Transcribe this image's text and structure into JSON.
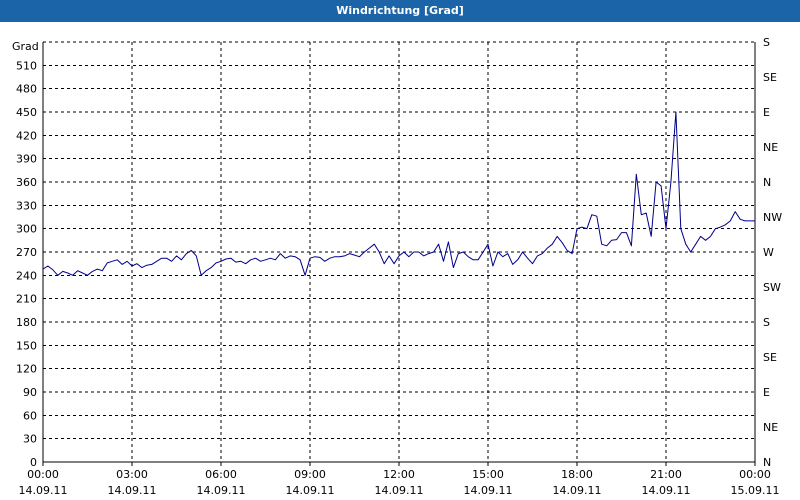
{
  "window": {
    "title": "Windrichtung [Grad]"
  },
  "colors": {
    "title_bar": "#1c64a8",
    "series": "#00008b",
    "grid": "#000000"
  },
  "chart_data": {
    "type": "line",
    "title": "Windrichtung [Grad]",
    "ylabel": "Grad",
    "ylim": [
      0,
      540
    ],
    "xlim": [
      "14.09.11 00:00",
      "15.09.11 00:00"
    ],
    "grid": true,
    "y_ticks": [
      0,
      30,
      60,
      90,
      120,
      150,
      180,
      210,
      240,
      270,
      300,
      330,
      360,
      390,
      420,
      450,
      480,
      510
    ],
    "x_ticks": [
      {
        "time": "00:00",
        "date": "14.09.11"
      },
      {
        "time": "03:00",
        "date": "14.09.11"
      },
      {
        "time": "06:00",
        "date": "14.09.11"
      },
      {
        "time": "09:00",
        "date": "14.09.11"
      },
      {
        "time": "12:00",
        "date": "14.09.11"
      },
      {
        "time": "15:00",
        "date": "14.09.11"
      },
      {
        "time": "18:00",
        "date": "14.09.11"
      },
      {
        "time": "21:00",
        "date": "14.09.11"
      },
      {
        "time": "00:00",
        "date": "15.09.11"
      }
    ],
    "right_axis": {
      "labels": [
        {
          "value": 0,
          "label": "N"
        },
        {
          "value": 45,
          "label": "NE"
        },
        {
          "value": 90,
          "label": "E"
        },
        {
          "value": 135,
          "label": "SE"
        },
        {
          "value": 180,
          "label": "S"
        },
        {
          "value": 225,
          "label": "SW"
        },
        {
          "value": 270,
          "label": "W"
        },
        {
          "value": 315,
          "label": "NW"
        },
        {
          "value": 360,
          "label": "N"
        },
        {
          "value": 405,
          "label": "NE"
        },
        {
          "value": 450,
          "label": "E"
        },
        {
          "value": 495,
          "label": "SE"
        },
        {
          "value": 540,
          "label": "S"
        }
      ]
    },
    "series": [
      {
        "x": [
          "00:00",
          "00:10",
          "00:20",
          "00:30",
          "00:40",
          "00:50",
          "01:00",
          "01:10",
          "01:20",
          "01:30",
          "01:40",
          "01:50",
          "02:00",
          "02:10",
          "02:20",
          "02:30",
          "02:40",
          "02:50",
          "03:00",
          "03:10",
          "03:20",
          "03:30",
          "03:40",
          "03:50",
          "04:00",
          "04:10",
          "04:20",
          "04:30",
          "04:40",
          "04:50",
          "05:00",
          "05:10",
          "05:20",
          "05:30",
          "05:40",
          "05:50",
          "06:00",
          "06:10",
          "06:20",
          "06:30",
          "06:40",
          "06:50",
          "07:00",
          "07:10",
          "07:20",
          "07:30",
          "07:40",
          "07:50",
          "08:00",
          "08:10",
          "08:20",
          "08:30",
          "08:40",
          "08:50",
          "09:00",
          "09:10",
          "09:20",
          "09:30",
          "09:40",
          "09:50",
          "10:00",
          "10:10",
          "10:20",
          "10:30",
          "10:40",
          "10:50",
          "11:00",
          "11:10",
          "11:20",
          "11:30",
          "11:40",
          "11:50",
          "12:00",
          "12:10",
          "12:20",
          "12:30",
          "12:40",
          "12:50",
          "13:00",
          "13:10",
          "13:20",
          "13:30",
          "13:40",
          "13:50",
          "14:00",
          "14:10",
          "14:20",
          "14:30",
          "14:40",
          "14:50",
          "15:00",
          "15:10",
          "15:20",
          "15:30",
          "15:40",
          "15:50",
          "16:00",
          "16:10",
          "16:20",
          "16:30",
          "16:40",
          "16:50",
          "17:00",
          "17:10",
          "17:20",
          "17:30",
          "17:40",
          "17:50",
          "18:00",
          "18:10",
          "18:20",
          "18:30",
          "18:40",
          "18:50",
          "19:00",
          "19:10",
          "19:20",
          "19:30",
          "19:40",
          "19:50",
          "20:00",
          "20:10",
          "20:20",
          "20:30",
          "20:40",
          "20:50",
          "21:00",
          "21:10",
          "21:20",
          "21:30",
          "21:40",
          "21:50",
          "22:00",
          "22:10",
          "22:20",
          "22:30",
          "22:40",
          "22:50",
          "23:00",
          "23:10",
          "23:20",
          "23:30",
          "23:40",
          "23:50",
          "24:00"
        ],
        "values": [
          248,
          252,
          247,
          240,
          245,
          243,
          240,
          246,
          243,
          240,
          245,
          248,
          246,
          256,
          258,
          260,
          254,
          258,
          252,
          255,
          250,
          253,
          254,
          258,
          262,
          262,
          258,
          265,
          260,
          268,
          272,
          265,
          240,
          246,
          250,
          256,
          258,
          261,
          262,
          257,
          258,
          255,
          260,
          262,
          258,
          260,
          262,
          260,
          268,
          262,
          265,
          264,
          260,
          240,
          262,
          264,
          263,
          258,
          262,
          264,
          264,
          265,
          268,
          266,
          264,
          270,
          275,
          280,
          270,
          255,
          265,
          255,
          265,
          270,
          264,
          270,
          270,
          265,
          268,
          270,
          280,
          258,
          283,
          250,
          268,
          270,
          264,
          260,
          260,
          270,
          280,
          252,
          270,
          264,
          268,
          254,
          260,
          270,
          262,
          255,
          265,
          268,
          275,
          280,
          290,
          282,
          272,
          268,
          300,
          302,
          300,
          318,
          316,
          280,
          278,
          285,
          286,
          295,
          295,
          278,
          370,
          318,
          320,
          290,
          360,
          355,
          300,
          360,
          450,
          300,
          280,
          270,
          280,
          290,
          285,
          290,
          300,
          302,
          305,
          310,
          322,
          312,
          310,
          310,
          310
        ]
      }
    ]
  }
}
